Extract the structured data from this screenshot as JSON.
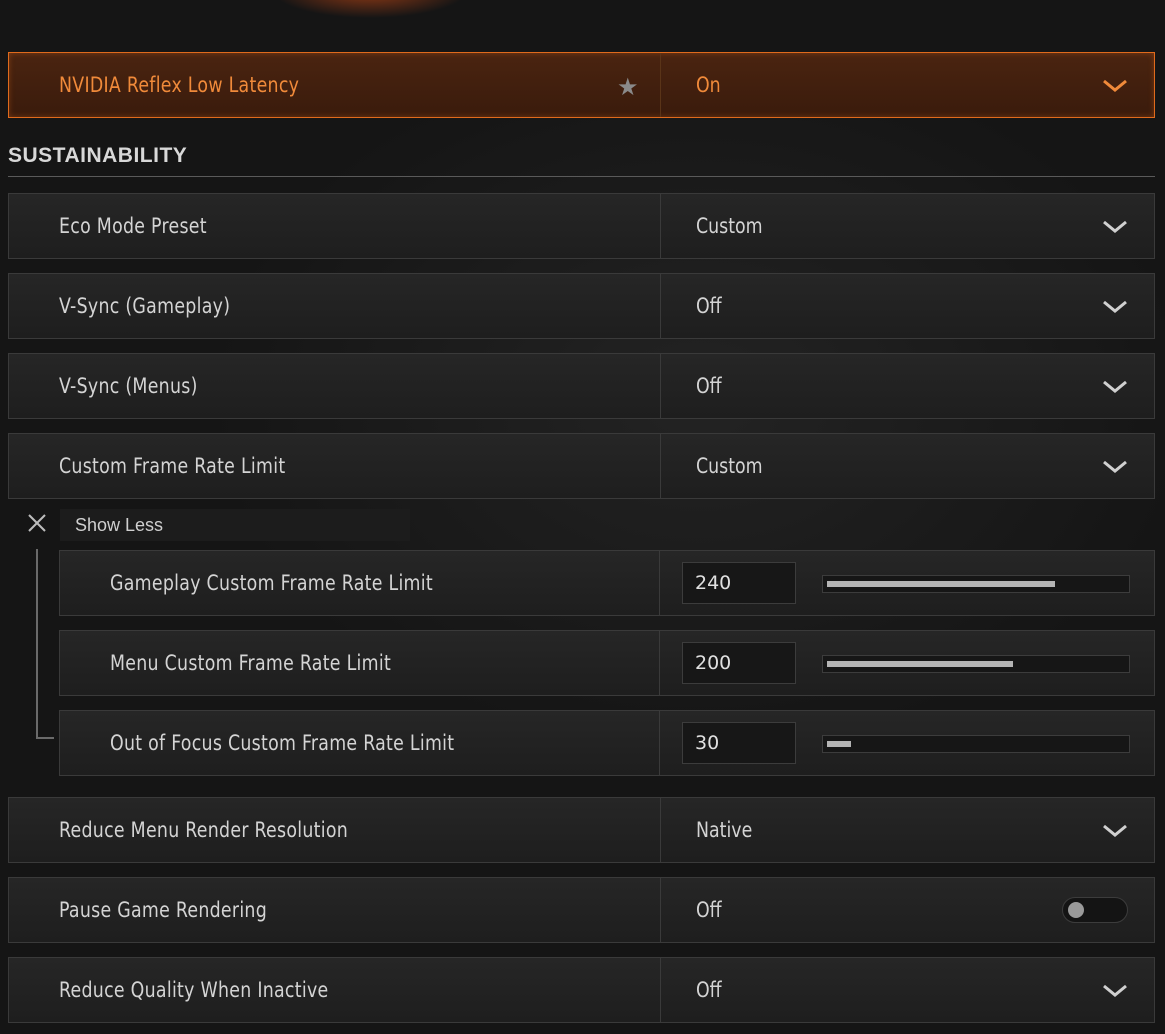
{
  "rows": {
    "reflex": {
      "label": "NVIDIA Reflex Low Latency",
      "value": "On"
    },
    "eco": {
      "label": "Eco Mode Preset",
      "value": "Custom"
    },
    "vsync_gameplay": {
      "label": "V-Sync (Gameplay)",
      "value": "Off"
    },
    "vsync_menus": {
      "label": "V-Sync (Menus)",
      "value": "Off"
    },
    "custom_fps": {
      "label": "Custom Frame Rate Limit",
      "value": "Custom"
    },
    "gameplay_fps": {
      "label": "Gameplay Custom Frame Rate Limit",
      "value": "240",
      "fill": 0.76
    },
    "menu_fps": {
      "label": "Menu Custom Frame Rate Limit",
      "value": "200",
      "fill": 0.62
    },
    "focus_fps": {
      "label": "Out of Focus Custom Frame Rate Limit",
      "value": "30",
      "fill": 0.08
    },
    "menu_res": {
      "label": "Reduce Menu Render Resolution",
      "value": "Native"
    },
    "pause_render": {
      "label": "Pause Game Rendering",
      "value": "Off"
    },
    "reduce_quality": {
      "label": "Reduce Quality When Inactive",
      "value": "Off"
    }
  },
  "section": {
    "title": "SUSTAINABILITY"
  },
  "show_less": "Show Less",
  "icons": {
    "favorite": "star-icon",
    "dropdown": "chevron-down-icon",
    "collapse": "close-icon"
  },
  "colors": {
    "accent": "#f08a3a",
    "accent_border": "#e06a1c"
  }
}
